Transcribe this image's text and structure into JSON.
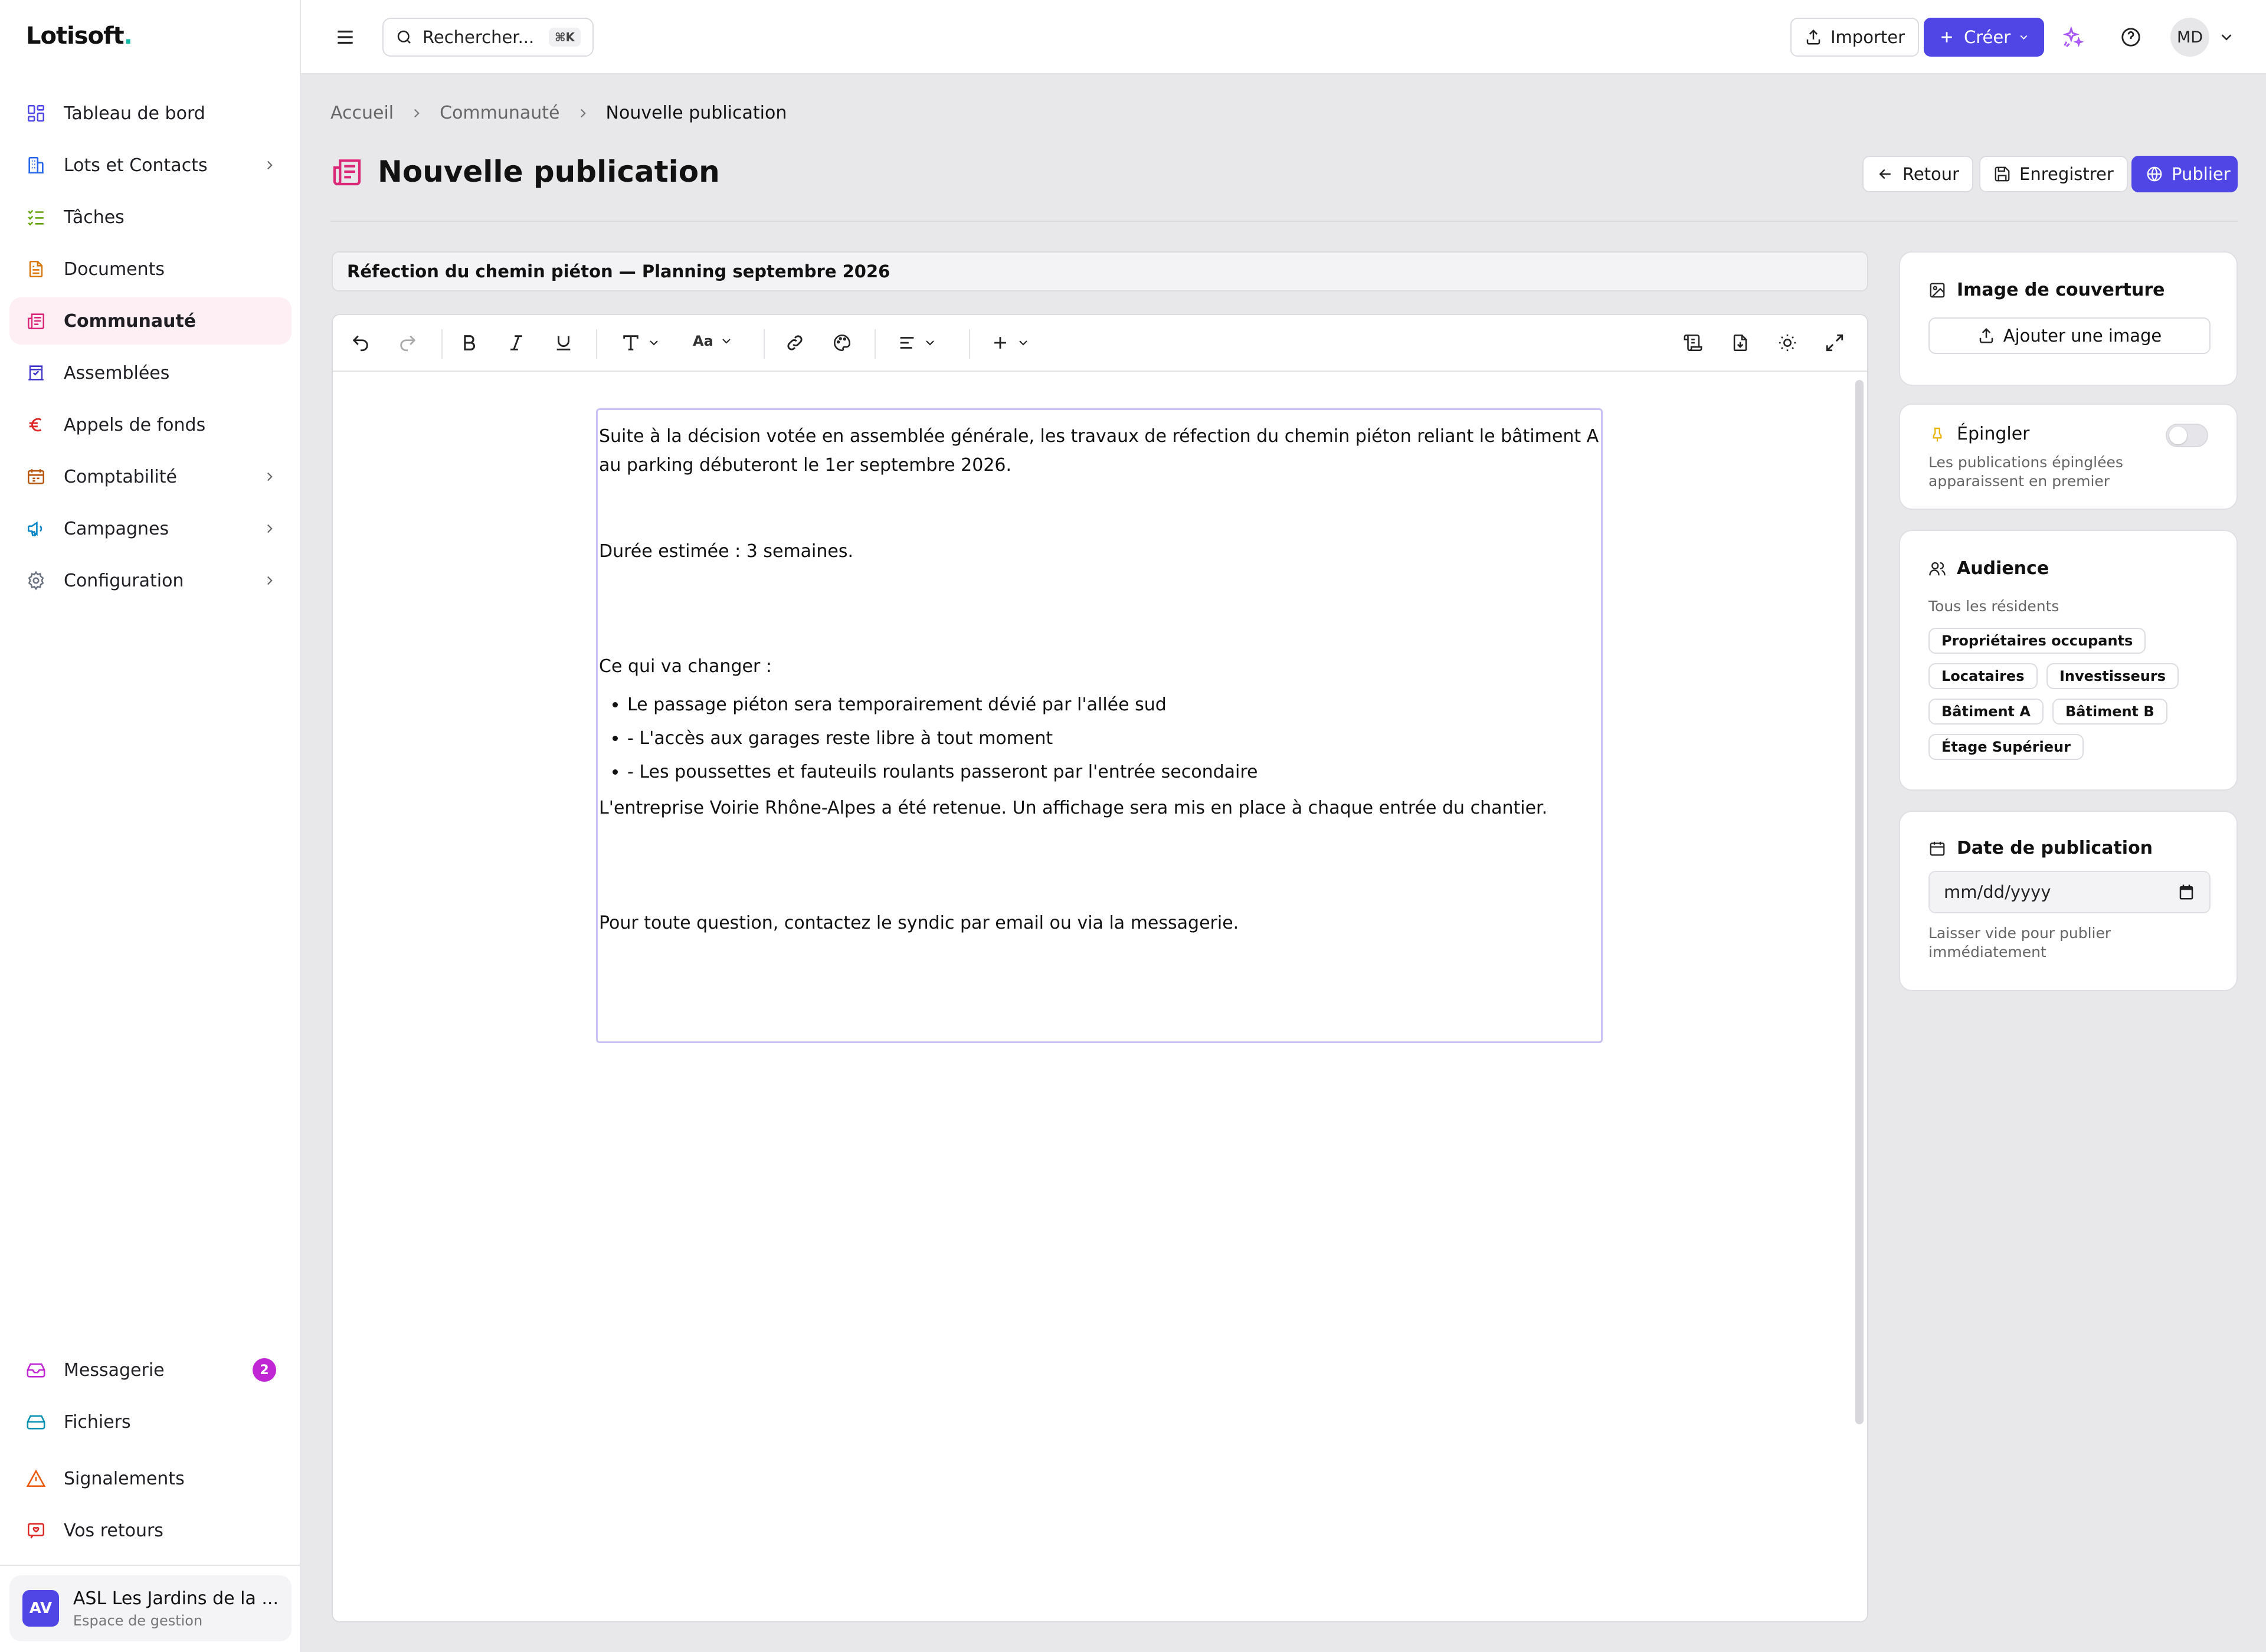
{
  "app": {
    "logo_text": "Lotisoft",
    "logo_dot": ".",
    "brand_color": "#4f46e5"
  },
  "sidebar": {
    "items": [
      {
        "label": "Tableau de bord",
        "icon": "dashboard-icon"
      },
      {
        "label": "Lots et Contacts",
        "icon": "building-icon",
        "has_children": true
      },
      {
        "label": "Tâches",
        "icon": "tasks-icon"
      },
      {
        "label": "Documents",
        "icon": "document-icon"
      },
      {
        "label": "Communauté",
        "icon": "newspaper-icon",
        "active": true
      },
      {
        "label": "Assemblées",
        "icon": "vote-icon"
      },
      {
        "label": "Appels de fonds",
        "icon": "euro-icon"
      },
      {
        "label": "Comptabilité",
        "icon": "ledger-icon",
        "has_children": true
      },
      {
        "label": "Campagnes",
        "icon": "megaphone-icon",
        "has_children": true
      },
      {
        "label": "Configuration",
        "icon": "gear-icon",
        "has_children": true
      }
    ],
    "bottom_items": [
      {
        "label": "Messagerie",
        "icon": "inbox-icon",
        "badge": "2"
      },
      {
        "label": "Fichiers",
        "icon": "drive-icon"
      },
      {
        "label": "Signalements",
        "icon": "warning-icon"
      },
      {
        "label": "Vos retours",
        "icon": "feedback-icon"
      }
    ],
    "org": {
      "initials": "AV",
      "name": "ASL Les Jardins de la ...",
      "subtitle": "Espace de gestion"
    }
  },
  "topbar": {
    "search_placeholder": "Rechercher...",
    "search_shortcut": "⌘K",
    "import_label": "Importer",
    "create_label": "Créer",
    "user_initials": "MD"
  },
  "breadcrumb": {
    "items": [
      "Accueil",
      "Communauté"
    ],
    "current": "Nouvelle publication"
  },
  "page": {
    "title": "Nouvelle publication",
    "back_label": "Retour",
    "save_label": "Enregistrer",
    "publish_label": "Publier"
  },
  "editor": {
    "post_title": "Réfection du chemin piéton — Planning septembre 2026",
    "font_size_label": "Aa",
    "paragraphs": {
      "intro": "Suite à la décision votée en assemblée générale, les travaux de réfection du chemin piéton reliant le bâtiment A au parking débuteront le 1er septembre 2026.",
      "duration": "Durée estimée : 3 semaines.",
      "changes_heading": "Ce qui va changer :",
      "list": [
        "Le passage piéton sera temporairement dévié par l'allée sud",
        "- L'accès aux garages reste libre à tout moment",
        "- Les poussettes et fauteuils roulants passeront par l'entrée secondaire"
      ],
      "contractor": "L'entreprise Voirie Rhône-Alpes a été retenue. Un affichage sera mis en place à chaque entrée du chantier.",
      "contact": "Pour toute question, contactez le syndic par email ou via la messagerie."
    }
  },
  "panel": {
    "cover": {
      "title": "Image de couverture",
      "button": "Ajouter une image"
    },
    "pin": {
      "title": "Épingler",
      "note": "Les publications épinglées apparaissent en premier",
      "enabled": false
    },
    "audience": {
      "title": "Audience",
      "note": "Tous les résidents",
      "chips": [
        "Propriétaires occupants",
        "Locataires",
        "Investisseurs",
        "Bâtiment A",
        "Bâtiment B",
        "Étage Supérieur"
      ]
    },
    "date": {
      "title": "Date de publication",
      "placeholder": "mm/dd/yyyy",
      "note": "Laisser vide pour publier immédiatement"
    }
  }
}
